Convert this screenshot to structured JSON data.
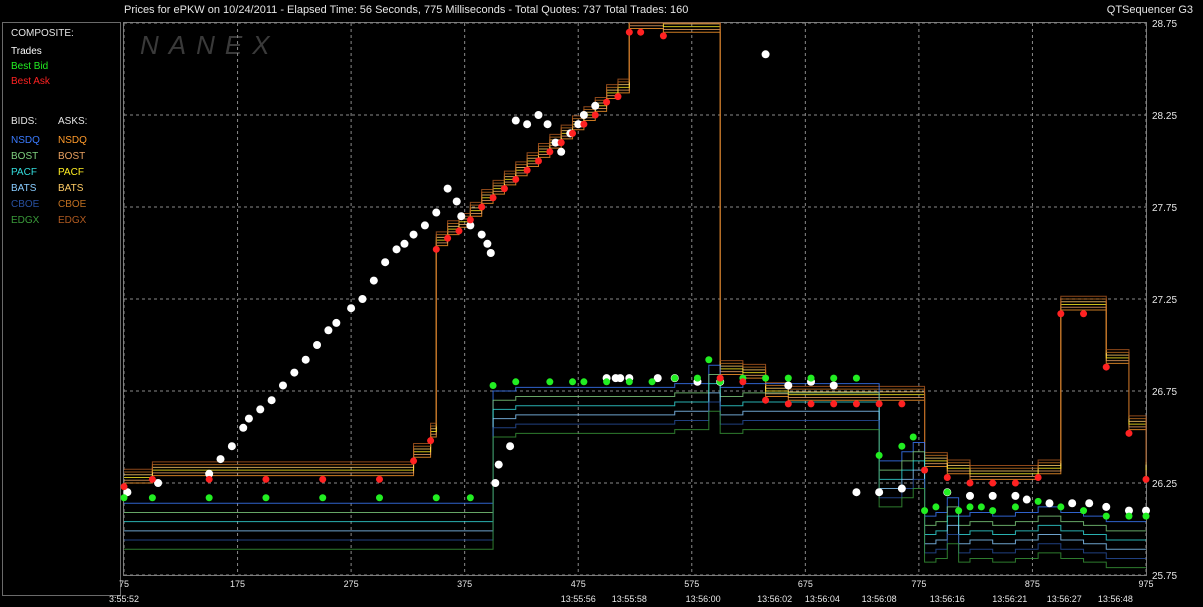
{
  "header": {
    "title": "Prices for  ePKW  on  10/24/2011  -  Elapsed Time: 56 Seconds, 775 Milliseconds  -  Total Quotes: 737  Total Trades: 160",
    "app": "QTSequencer G3",
    "watermark": "NANEX"
  },
  "legend": {
    "composite_title": "COMPOSITE:",
    "composite": [
      {
        "label": "Trades",
        "color": "#ffffff"
      },
      {
        "label": "Best Bid",
        "color": "#22ee22"
      },
      {
        "label": "Best Ask",
        "color": "#ff2222"
      }
    ],
    "bids_title": "BIDS:",
    "asks_title": "ASKS:",
    "exchanges": [
      {
        "bid": "NSDQ",
        "ask": "NSDQ",
        "bid_color": "#3b7bff",
        "ask_color": "#ff9a2a"
      },
      {
        "bid": "BOST",
        "ask": "BOST",
        "bid_color": "#7fd07f",
        "ask_color": "#e8a060"
      },
      {
        "bid": "PACF",
        "ask": "PACF",
        "bid_color": "#33dddd",
        "ask_color": "#ffee22"
      },
      {
        "bid": "BATS",
        "ask": "BATS",
        "bid_color": "#88ccff",
        "ask_color": "#ffcc66"
      },
      {
        "bid": "CBOE",
        "ask": "CBOE",
        "bid_color": "#2850a0",
        "ask_color": "#c07020"
      },
      {
        "bid": "EDGX",
        "ask": "EDGX",
        "bid_color": "#3a9a3a",
        "ask_color": "#b05a20"
      }
    ]
  },
  "chart_data": {
    "type": "scatter",
    "ylim": [
      25.75,
      28.75
    ],
    "xlim": [
      75,
      975
    ],
    "y_ticks": [
      "28.75",
      "28.25",
      "27.75",
      "27.25",
      "26.75",
      "26.25",
      "25.75"
    ],
    "y_tick_values": [
      28.75,
      28.25,
      27.75,
      27.25,
      26.75,
      26.25,
      25.75
    ],
    "x_ticks_seq": [
      "75",
      "175",
      "275",
      "375",
      "475",
      "575",
      "675",
      "775",
      "875",
      "975"
    ],
    "x_tick_values": [
      75,
      175,
      275,
      375,
      475,
      575,
      675,
      775,
      875,
      975
    ],
    "x_ticks_time": [
      {
        "seq": 75,
        "label": "3:55:52"
      },
      {
        "seq": 475,
        "label": "13:55:56"
      },
      {
        "seq": 520,
        "label": "13:55:58"
      },
      {
        "seq": 585,
        "label": "13:56:00"
      },
      {
        "seq": 648,
        "label": "13:56:02"
      },
      {
        "seq": 690,
        "label": "13:56:04"
      },
      {
        "seq": 740,
        "label": "13:56:08"
      },
      {
        "seq": 800,
        "label": "13:56:16"
      },
      {
        "seq": 855,
        "label": "13:56:21"
      },
      {
        "seq": 903,
        "label": "13:56:27"
      },
      {
        "seq": 948,
        "label": "13:56:48"
      }
    ],
    "grid": true,
    "series": [
      {
        "name": "Trades",
        "color": "#ffffff",
        "x": [
          78,
          105,
          150,
          160,
          170,
          180,
          185,
          195,
          205,
          215,
          225,
          235,
          245,
          255,
          262,
          275,
          285,
          295,
          305,
          315,
          322,
          330,
          340,
          350,
          360,
          368,
          372,
          380,
          390,
          395,
          398,
          402,
          405,
          415,
          420,
          430,
          440,
          448,
          455,
          460,
          468,
          475,
          480,
          490,
          500,
          508,
          512,
          520,
          545,
          560,
          580,
          600,
          640,
          660,
          680,
          700,
          720,
          740,
          760,
          800,
          820,
          840,
          860,
          870,
          890,
          910,
          925,
          940,
          960,
          975
        ],
        "y": [
          26.2,
          26.25,
          26.3,
          26.38,
          26.45,
          26.55,
          26.6,
          26.65,
          26.7,
          26.78,
          26.85,
          26.92,
          27.0,
          27.08,
          27.12,
          27.2,
          27.25,
          27.35,
          27.45,
          27.52,
          27.55,
          27.6,
          27.65,
          27.72,
          27.85,
          27.78,
          27.7,
          27.65,
          27.6,
          27.55,
          27.5,
          26.25,
          26.35,
          26.45,
          28.22,
          28.2,
          28.25,
          28.2,
          28.1,
          28.05,
          28.15,
          28.2,
          28.25,
          28.3,
          26.82,
          26.82,
          26.82,
          26.82,
          26.82,
          26.82,
          26.8,
          26.8,
          28.58,
          26.78,
          26.8,
          26.78,
          26.2,
          26.2,
          26.22,
          26.2,
          26.18,
          26.18,
          26.18,
          26.16,
          26.14,
          26.14,
          26.14,
          26.12,
          26.1,
          26.1
        ]
      },
      {
        "name": "Best Bid",
        "color": "#22ee22",
        "x": [
          75,
          100,
          150,
          200,
          250,
          300,
          350,
          380,
          400,
          420,
          450,
          470,
          480,
          500,
          520,
          540,
          560,
          580,
          590,
          600,
          620,
          640,
          660,
          680,
          700,
          720,
          740,
          760,
          770,
          780,
          790,
          800,
          810,
          820,
          830,
          840,
          860,
          880,
          900,
          920,
          940,
          960,
          975
        ],
        "y": [
          26.17,
          26.17,
          26.17,
          26.17,
          26.17,
          26.17,
          26.17,
          26.17,
          26.78,
          26.8,
          26.8,
          26.8,
          26.8,
          26.8,
          26.8,
          26.8,
          26.82,
          26.82,
          26.92,
          26.8,
          26.82,
          26.82,
          26.82,
          26.82,
          26.82,
          26.82,
          26.4,
          26.45,
          26.5,
          26.1,
          26.12,
          26.2,
          26.1,
          26.12,
          26.12,
          26.1,
          26.12,
          26.15,
          26.12,
          26.1,
          26.07,
          26.07,
          26.07
        ]
      },
      {
        "name": "Best Ask",
        "color": "#ff2222",
        "x": [
          75,
          100,
          150,
          200,
          250,
          300,
          330,
          345,
          350,
          360,
          370,
          380,
          390,
          400,
          410,
          420,
          430,
          440,
          450,
          460,
          470,
          480,
          490,
          500,
          510,
          520,
          530,
          550,
          600,
          620,
          640,
          660,
          680,
          700,
          720,
          740,
          760,
          780,
          800,
          820,
          840,
          860,
          880,
          900,
          920,
          940,
          960,
          975
        ],
        "y": [
          26.23,
          26.27,
          26.27,
          26.27,
          26.27,
          26.27,
          26.37,
          26.48,
          27.52,
          27.58,
          27.62,
          27.68,
          27.75,
          27.8,
          27.85,
          27.9,
          27.95,
          28.0,
          28.05,
          28.1,
          28.15,
          28.2,
          28.25,
          28.32,
          28.35,
          28.7,
          28.7,
          28.68,
          26.82,
          26.8,
          26.7,
          26.68,
          26.68,
          26.68,
          26.68,
          26.68,
          26.68,
          26.32,
          26.28,
          26.25,
          26.25,
          26.25,
          26.28,
          27.17,
          27.17,
          26.88,
          26.52,
          26.27
        ]
      }
    ]
  }
}
